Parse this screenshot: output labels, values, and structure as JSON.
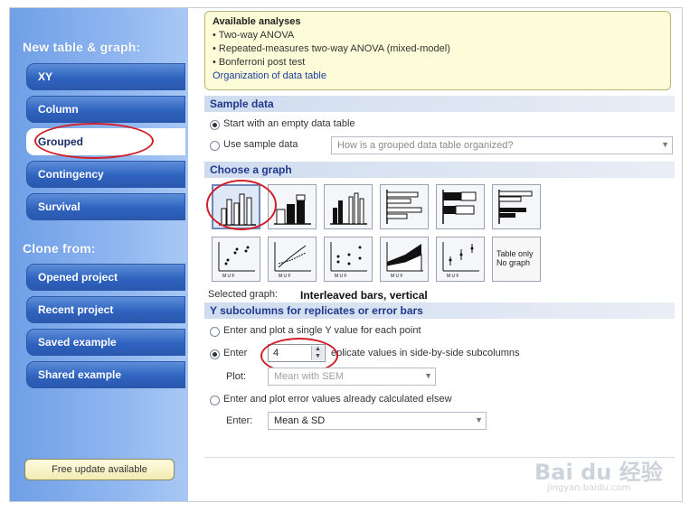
{
  "sidebar": {
    "new_heading": "New table & graph:",
    "new_items": [
      "XY",
      "Column",
      "Grouped",
      "Contingency",
      "Survival"
    ],
    "active_item": "Grouped",
    "clone_heading": "Clone from:",
    "clone_items": [
      "Opened project",
      "Recent project",
      "Saved example",
      "Shared example"
    ],
    "update_button": "Free update available"
  },
  "analyses": {
    "title": "Available analyses",
    "items": [
      "• Two-way ANOVA",
      "• Repeated-measures two-way ANOVA (mixed-model)",
      "• Bonferroni post test"
    ],
    "link": "Organization of data table"
  },
  "sample_data": {
    "heading": "Sample data",
    "option_empty": "Start with an empty data table",
    "option_sample": "Use sample data",
    "sample_placeholder": "How is a grouped data table organized?"
  },
  "choose_graph": {
    "heading": "Choose a graph",
    "table_only_label": [
      "Table only",
      "No graph"
    ],
    "selected_label": "Selected graph:",
    "selected_value": "Interleaved bars, vertical"
  },
  "subcolumns": {
    "heading": "Y subcolumns for replicates or error bars",
    "option_single": "Enter and plot a single Y value for each point",
    "option_enter": "Enter",
    "replicate_count": "4",
    "replicate_suffix": "eplicate values in side-by-side subcolumns",
    "plot_label": "Plot:",
    "plot_value": "Mean with SEM",
    "option_error": "Enter and plot error values already calculated elsew",
    "enter_label": "Enter:",
    "enter_value": "Mean & SD"
  },
  "watermark": {
    "brand": "Bai du 经验",
    "url": "jingyan.baidu.com"
  },
  "colors": {
    "sidebar_blue": "#2f63c0",
    "annotation_red": "#d0202a",
    "info_panel": "#fcfcd8"
  }
}
